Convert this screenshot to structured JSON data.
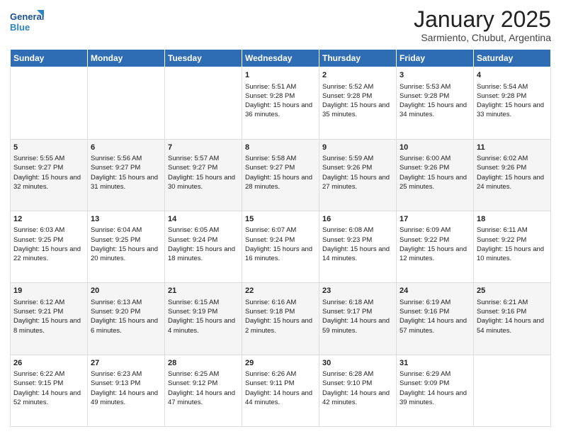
{
  "header": {
    "logo_general": "General",
    "logo_blue": "Blue",
    "month_year": "January 2025",
    "location": "Sarmiento, Chubut, Argentina"
  },
  "weekdays": [
    "Sunday",
    "Monday",
    "Tuesday",
    "Wednesday",
    "Thursday",
    "Friday",
    "Saturday"
  ],
  "weeks": [
    [
      {
        "day": "",
        "info": ""
      },
      {
        "day": "",
        "info": ""
      },
      {
        "day": "",
        "info": ""
      },
      {
        "day": "1",
        "info": "Sunrise: 5:51 AM\nSunset: 9:28 PM\nDaylight: 15 hours and 36 minutes."
      },
      {
        "day": "2",
        "info": "Sunrise: 5:52 AM\nSunset: 9:28 PM\nDaylight: 15 hours and 35 minutes."
      },
      {
        "day": "3",
        "info": "Sunrise: 5:53 AM\nSunset: 9:28 PM\nDaylight: 15 hours and 34 minutes."
      },
      {
        "day": "4",
        "info": "Sunrise: 5:54 AM\nSunset: 9:28 PM\nDaylight: 15 hours and 33 minutes."
      }
    ],
    [
      {
        "day": "5",
        "info": "Sunrise: 5:55 AM\nSunset: 9:27 PM\nDaylight: 15 hours and 32 minutes."
      },
      {
        "day": "6",
        "info": "Sunrise: 5:56 AM\nSunset: 9:27 PM\nDaylight: 15 hours and 31 minutes."
      },
      {
        "day": "7",
        "info": "Sunrise: 5:57 AM\nSunset: 9:27 PM\nDaylight: 15 hours and 30 minutes."
      },
      {
        "day": "8",
        "info": "Sunrise: 5:58 AM\nSunset: 9:27 PM\nDaylight: 15 hours and 28 minutes."
      },
      {
        "day": "9",
        "info": "Sunrise: 5:59 AM\nSunset: 9:26 PM\nDaylight: 15 hours and 27 minutes."
      },
      {
        "day": "10",
        "info": "Sunrise: 6:00 AM\nSunset: 9:26 PM\nDaylight: 15 hours and 25 minutes."
      },
      {
        "day": "11",
        "info": "Sunrise: 6:02 AM\nSunset: 9:26 PM\nDaylight: 15 hours and 24 minutes."
      }
    ],
    [
      {
        "day": "12",
        "info": "Sunrise: 6:03 AM\nSunset: 9:25 PM\nDaylight: 15 hours and 22 minutes."
      },
      {
        "day": "13",
        "info": "Sunrise: 6:04 AM\nSunset: 9:25 PM\nDaylight: 15 hours and 20 minutes."
      },
      {
        "day": "14",
        "info": "Sunrise: 6:05 AM\nSunset: 9:24 PM\nDaylight: 15 hours and 18 minutes."
      },
      {
        "day": "15",
        "info": "Sunrise: 6:07 AM\nSunset: 9:24 PM\nDaylight: 15 hours and 16 minutes."
      },
      {
        "day": "16",
        "info": "Sunrise: 6:08 AM\nSunset: 9:23 PM\nDaylight: 15 hours and 14 minutes."
      },
      {
        "day": "17",
        "info": "Sunrise: 6:09 AM\nSunset: 9:22 PM\nDaylight: 15 hours and 12 minutes."
      },
      {
        "day": "18",
        "info": "Sunrise: 6:11 AM\nSunset: 9:22 PM\nDaylight: 15 hours and 10 minutes."
      }
    ],
    [
      {
        "day": "19",
        "info": "Sunrise: 6:12 AM\nSunset: 9:21 PM\nDaylight: 15 hours and 8 minutes."
      },
      {
        "day": "20",
        "info": "Sunrise: 6:13 AM\nSunset: 9:20 PM\nDaylight: 15 hours and 6 minutes."
      },
      {
        "day": "21",
        "info": "Sunrise: 6:15 AM\nSunset: 9:19 PM\nDaylight: 15 hours and 4 minutes."
      },
      {
        "day": "22",
        "info": "Sunrise: 6:16 AM\nSunset: 9:18 PM\nDaylight: 15 hours and 2 minutes."
      },
      {
        "day": "23",
        "info": "Sunrise: 6:18 AM\nSunset: 9:17 PM\nDaylight: 14 hours and 59 minutes."
      },
      {
        "day": "24",
        "info": "Sunrise: 6:19 AM\nSunset: 9:16 PM\nDaylight: 14 hours and 57 minutes."
      },
      {
        "day": "25",
        "info": "Sunrise: 6:21 AM\nSunset: 9:16 PM\nDaylight: 14 hours and 54 minutes."
      }
    ],
    [
      {
        "day": "26",
        "info": "Sunrise: 6:22 AM\nSunset: 9:15 PM\nDaylight: 14 hours and 52 minutes."
      },
      {
        "day": "27",
        "info": "Sunrise: 6:23 AM\nSunset: 9:13 PM\nDaylight: 14 hours and 49 minutes."
      },
      {
        "day": "28",
        "info": "Sunrise: 6:25 AM\nSunset: 9:12 PM\nDaylight: 14 hours and 47 minutes."
      },
      {
        "day": "29",
        "info": "Sunrise: 6:26 AM\nSunset: 9:11 PM\nDaylight: 14 hours and 44 minutes."
      },
      {
        "day": "30",
        "info": "Sunrise: 6:28 AM\nSunset: 9:10 PM\nDaylight: 14 hours and 42 minutes."
      },
      {
        "day": "31",
        "info": "Sunrise: 6:29 AM\nSunset: 9:09 PM\nDaylight: 14 hours and 39 minutes."
      },
      {
        "day": "",
        "info": ""
      }
    ]
  ]
}
